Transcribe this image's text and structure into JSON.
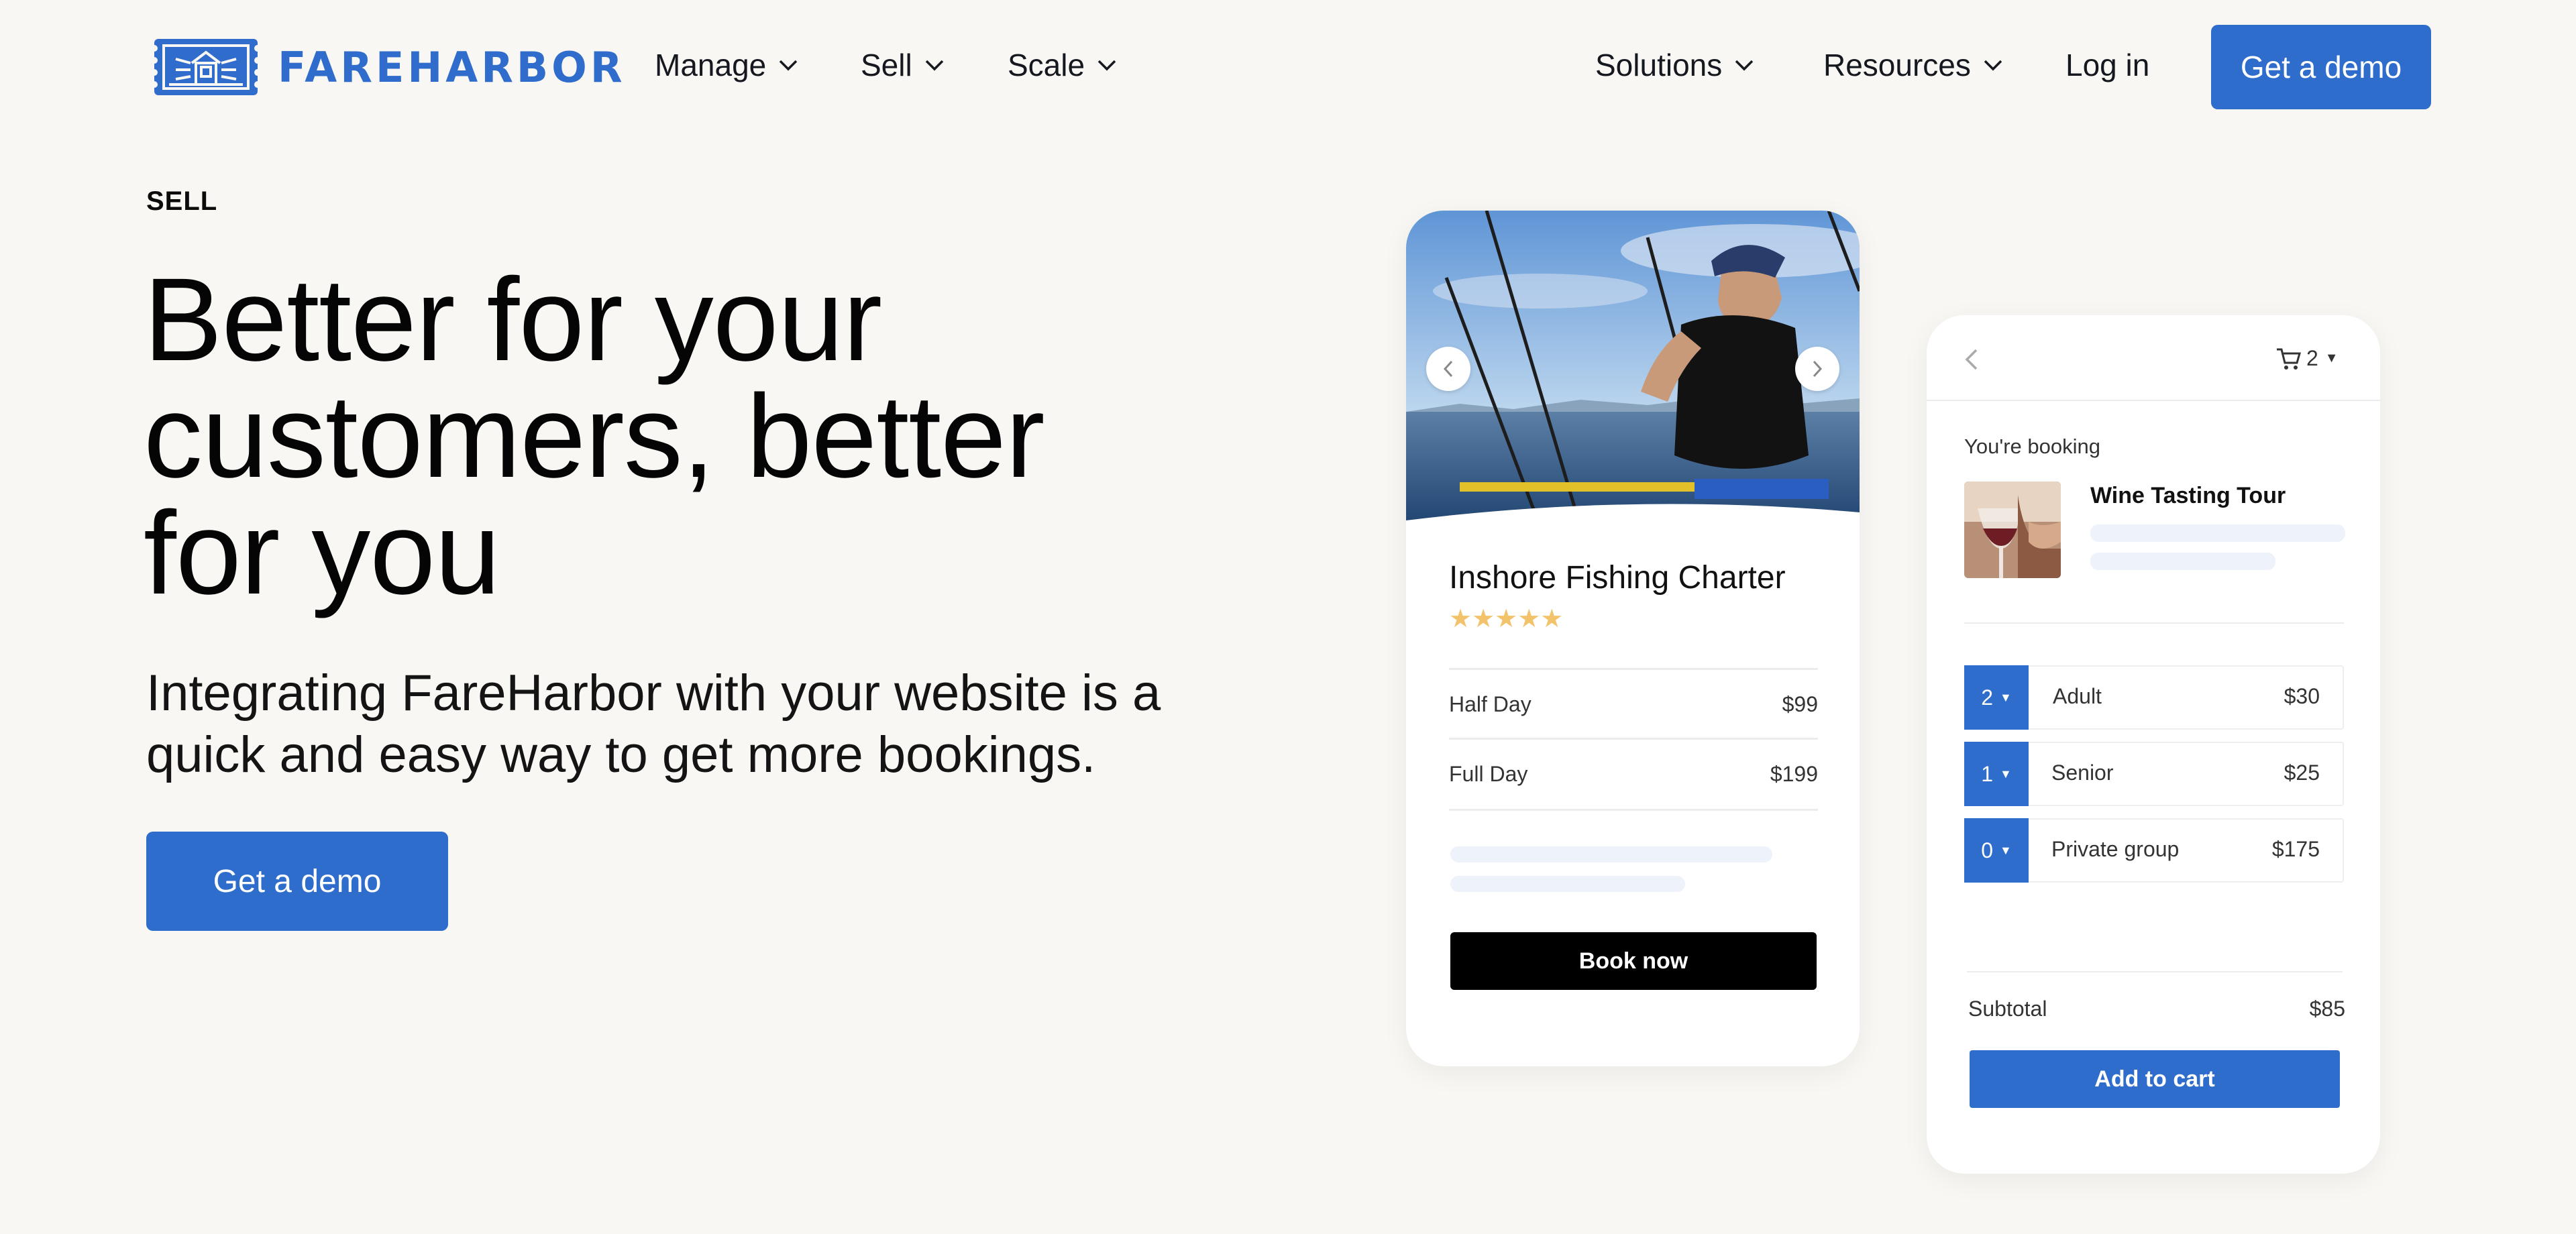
{
  "nav": {
    "brand": "FAREHARBOR",
    "left_items": [
      {
        "label": "Manage"
      },
      {
        "label": "Sell"
      },
      {
        "label": "Scale"
      }
    ],
    "right_items": [
      {
        "label": "Solutions"
      },
      {
        "label": "Resources"
      }
    ],
    "login_label": "Log in",
    "demo_label": "Get a demo"
  },
  "hero": {
    "eyebrow": "SELL",
    "headline_lines": [
      "Better for your",
      "customers, better",
      "for you"
    ],
    "subhead_lines": [
      "Integrating FareHarbor with your website is a",
      "quick and easy way to get more bookings."
    ],
    "cta_label": "Get a demo"
  },
  "listing_card": {
    "title": "Inshore Fishing Charter",
    "rating": "★★★★★",
    "options": [
      {
        "name": "Half Day",
        "price": "$99"
      },
      {
        "name": "Full Day",
        "price": "$199"
      }
    ],
    "book_label": "Book now"
  },
  "booking_card": {
    "cart_count": "2",
    "booking_label": "You're booking",
    "tour_name": "Wine Tasting Tour",
    "rows": [
      {
        "qty": "2",
        "name": "Adult",
        "price": "$30"
      },
      {
        "qty": "1",
        "name": "Senior",
        "price": "$25"
      },
      {
        "qty": "0",
        "name": "Private group",
        "price": "$175"
      }
    ],
    "subtotal_label": "Subtotal",
    "subtotal_value": "$85",
    "add_label": "Add to cart"
  },
  "colors": {
    "brand_blue": "#2e6dcb",
    "background": "#f9f7f3",
    "star": "#f2c36b"
  },
  "icons": [
    "logo-mark-icon",
    "chevron-down-icon",
    "chevron-left-icon",
    "chevron-right-icon",
    "cart-icon",
    "caret-down-icon",
    "star-icon"
  ]
}
